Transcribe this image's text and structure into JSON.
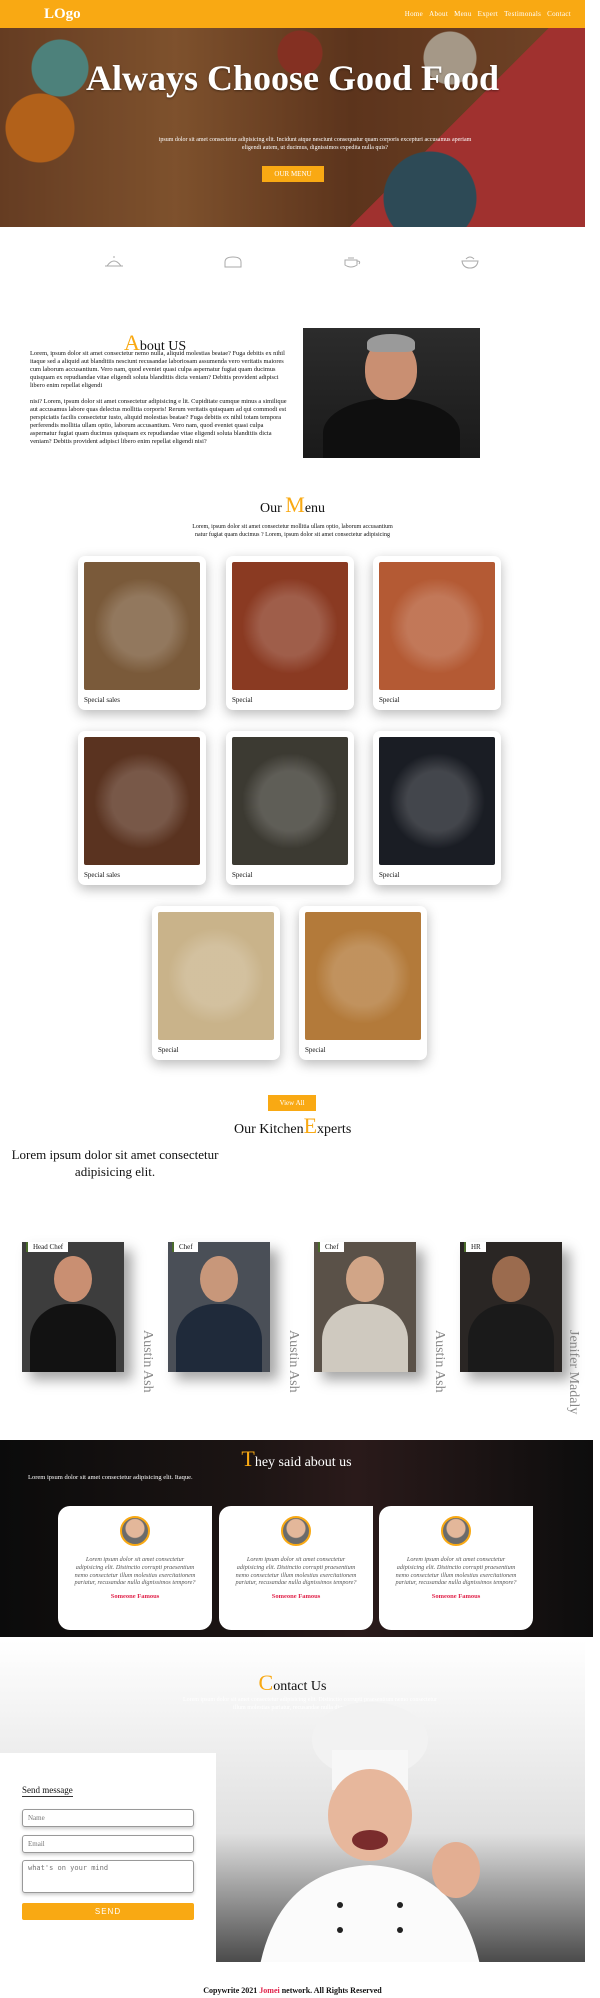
{
  "header": {
    "logo": "LOgo",
    "nav": [
      "Home",
      "About",
      "Menu",
      "Expert",
      "Testimonals",
      "Contact"
    ]
  },
  "hero": {
    "title": "Always Choose Good Food",
    "text": "ipsum dolor sit amet consectetur adipisicing elit. Incidunt atque nesciunt consequatur quam corporis excepturi accusamus aperiam eligendi autem, ut ducimus, dignissimos expedita nulla quis?",
    "button": "OUR MENU"
  },
  "services": [
    "dish-icon",
    "bread-icon",
    "teapot-icon",
    "bowl-icon"
  ],
  "about": {
    "title_cap": "A",
    "title_rest": "bout US",
    "p1": "Lorem, ipsum dolor sit amet consectetur nemo nulla, aliquid molestias beatae? Fuga debitis ex nihil itaque sed a aliquid aut blanditiis nesciunt recusandae laboriosam assumenda vero veritatis maiores cum laborum accusantium. Vero nam, quod eveniet quasi culpa aspernatur fugiat quam ducimus quisquam ex repudiandae vitae eligendi soluta blanditiis dicta veniam? Debitis provident adipisci libero enim repellat eligendi",
    "p2": "nisi? Lorem, ipsum dolor sit amet consectetur adipisicing e lit. Cupiditate cumque minus a similique aut accusamus labore quas delectus mollitia corporis! Rerum veritatis quisquam ad qui commodi est perspiciatis facilis consectetur iusto, aliquid molestias beatae? Fuga debitis ex nihil totam tempora perferendis mollitia ullam optio, laborum accusantium. Vero nam, quod eveniet quasi culpa aspernatur fugiat quam ducimus quisquam ex repudiandae vitae eligendi soluta blanditiis dicta veniam? Debitis provident adipisci libero enim repellat eligendi nisi?"
  },
  "menu": {
    "title_pre": "Our ",
    "title_cap": "M",
    "title_rest": "enu",
    "subtitle": "Lorem, ipsum dolor sit amet consectetur mollitia ullam optio, laborum accusantium natur fugiat quam ducimus ? Lorem, ipsum dolor sit amet consectetur adipisicing",
    "items": [
      {
        "label": "Special sales",
        "color": "#7a5a3a"
      },
      {
        "label": "Special",
        "color": "#8a3a22"
      },
      {
        "label": "Special",
        "color": "#b45a34"
      },
      {
        "label": "Special sales",
        "color": "#5a3320"
      },
      {
        "label": "Special",
        "color": "#3c3a32"
      },
      {
        "label": "Special",
        "color": "#1a1d24"
      },
      {
        "label": "Special",
        "color": "#c9b38a"
      },
      {
        "label": "Special",
        "color": "#b37a3a"
      }
    ],
    "view_all": "View All"
  },
  "experts": {
    "title_pre": "Our Kitchen",
    "title_cap": "E",
    "title_rest": "xperts",
    "subtitle": "Lorem ipsum dolor sit amet consectetur adipisicing elit.",
    "people": [
      {
        "role": "Head Chef",
        "name": "Austin Ash",
        "bg": "#3d3d3d",
        "face": "#c98f72",
        "body": "#121212"
      },
      {
        "role": "Chef",
        "name": "Austin Ash",
        "bg": "#4a4f57",
        "face": "#c8977a",
        "body": "#1f2a3a"
      },
      {
        "role": "Chef",
        "name": "Austin Ash",
        "bg": "#5a5148",
        "face": "#d1a587",
        "body": "#cfc9bf"
      },
      {
        "role": "HR",
        "name": "Jenifer Madaly",
        "bg": "#2a2624",
        "face": "#9b6b4e",
        "body": "#1a1a1a"
      }
    ]
  },
  "testimonials": {
    "title_cap": "T",
    "title_rest": "hey said about us",
    "subtitle": "Lorem ipsum dolor sit amet consectetur adipisicing elit. Itaque.",
    "items": [
      {
        "quote": "Lorem ipsum dolor sit amet consectetur adipisicing elit. Distinctio corrupti praesentium nemo consectetur illum molestias exercitationem pariatur, recusandae nulla dignissimos tempore?",
        "name": "Someone Famous"
      },
      {
        "quote": "Lorem ipsum dolor sit amet consectetur adipisicing elit. Distinctio corrupti praesentium nemo consectetur illum molestias exercitationem pariatur, recusandae nulla dignissimos tempore?",
        "name": "Someone Famous"
      },
      {
        "quote": "Lorem ipsum dolor sit amet consectetur adipisicing elit. Distinctio corrupti praesentium nemo consectetur illum molestias exercitationem pariatur, recusandae nulla dignissimos tempore?",
        "name": "Someone Famous"
      }
    ]
  },
  "contact": {
    "title_cap": "C",
    "title_rest": "ontact Us",
    "subtitle": "Lorem ipsum dolor sit amet consectetur adipisicing elit. Distinctio corrupti praesentium nemo consectetur illum molestias pariatur, recusandae nulla dignissimos tempore?",
    "form_title": "Send message",
    "name_placeholder": "Name",
    "email_placeholder": "Email",
    "message_placeholder": "what's on your mind",
    "send": "SEND"
  },
  "footer": {
    "pre": "Copywrite 2021 ",
    "brand": "Jomei",
    "post": " network. All Rights Reserved"
  },
  "colors": {
    "accent": "#f9a913",
    "brand_red": "#e0224a"
  }
}
